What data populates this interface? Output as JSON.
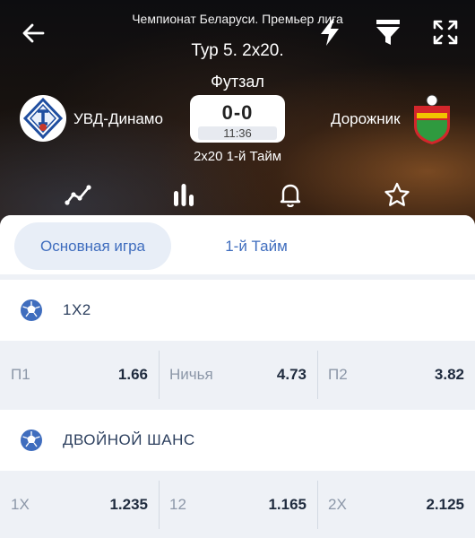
{
  "header": {
    "league": "Чемпионат Беларуси. Премьер лига",
    "round": "Тур 5. 2x20.",
    "sport": "Футзал",
    "home_team": "УВД-Динамо",
    "away_team": "Дорожник",
    "score": "0-0",
    "time": "11:36",
    "period": "2x20 1-й Тайм",
    "icons": [
      "back-arrow-icon",
      "lightning-icon",
      "filter-icon",
      "fullscreen-icon",
      "stats-line-icon",
      "bars-icon",
      "bell-icon",
      "star-icon"
    ]
  },
  "tabs": [
    {
      "label": "Основная игра",
      "active": true
    },
    {
      "label": "1-й Тайм",
      "active": false
    }
  ],
  "markets": [
    {
      "title": "1X2",
      "odds": [
        {
          "label": "П1",
          "value": "1.66"
        },
        {
          "label": "Ничья",
          "value": "4.73"
        },
        {
          "label": "П2",
          "value": "3.82"
        }
      ]
    },
    {
      "title": "ДВОЙНОЙ ШАНС",
      "odds": [
        {
          "label": "1X",
          "value": "1.235"
        },
        {
          "label": "12",
          "value": "1.165"
        },
        {
          "label": "2X",
          "value": "2.125"
        }
      ]
    }
  ],
  "colors": {
    "accent": "#3f6dbe",
    "header_bg": "#111114",
    "content_bg": "#eef1f6"
  }
}
